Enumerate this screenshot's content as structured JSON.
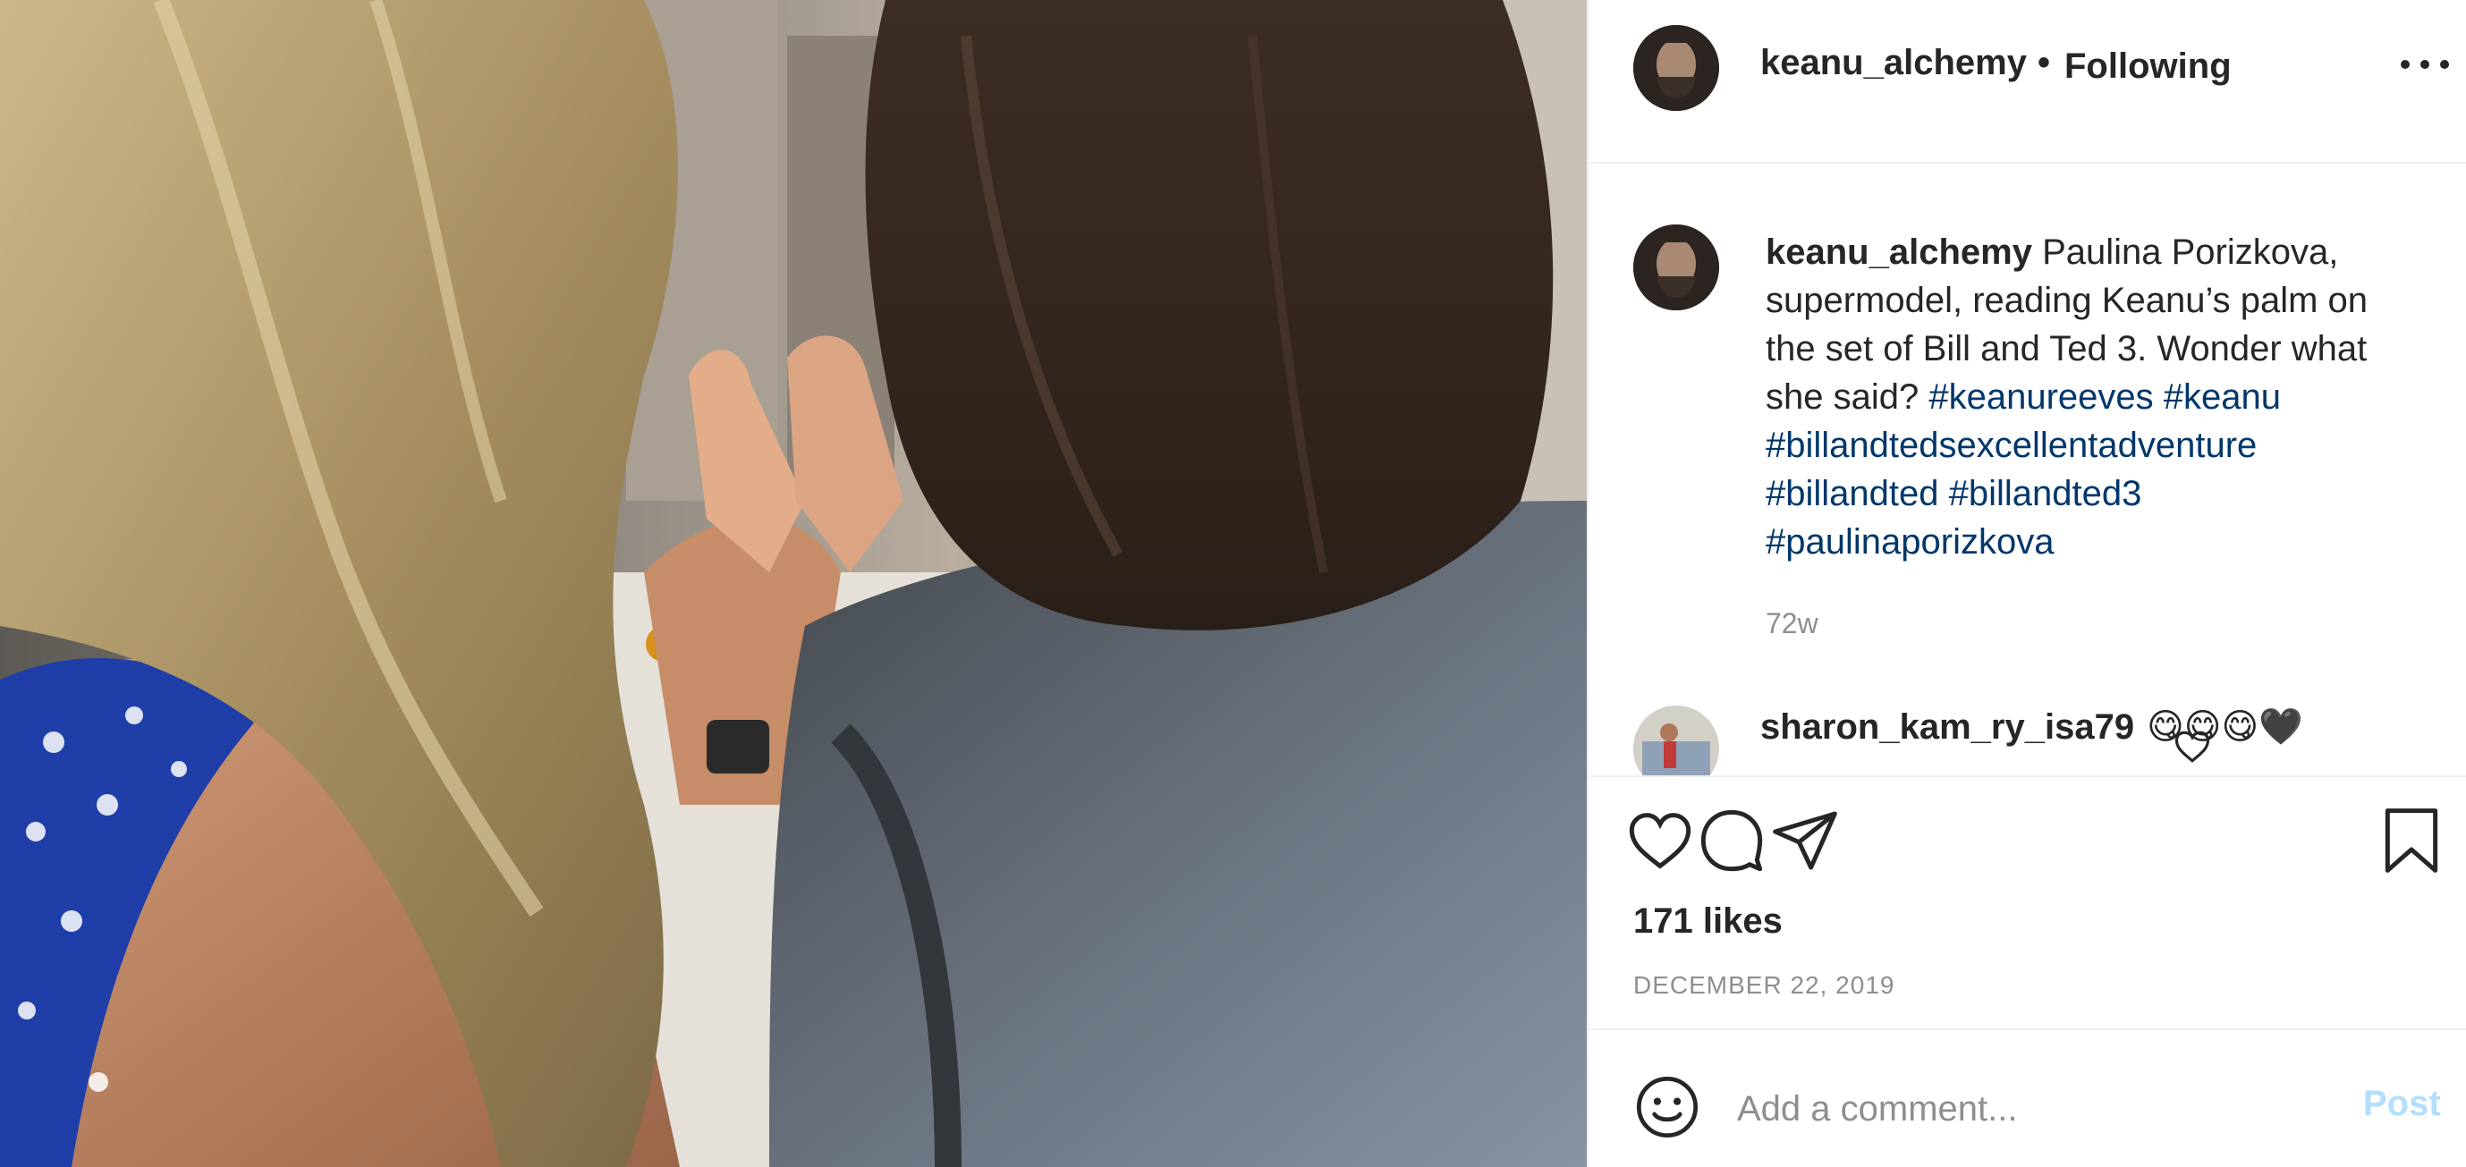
{
  "header": {
    "username": "keanu_alchemy",
    "separator": "•",
    "follow_status": "Following",
    "more_icon": "more-horizontal-icon"
  },
  "caption": {
    "username": "keanu_alchemy",
    "text": "Paulina Porizkova, supermodel, reading Keanu’s palm on the set of Bill and Ted 3. Wonder what she said?",
    "hashtags": [
      "#keanureeves",
      "#keanu",
      "#billandtedsexcellentadventure",
      "#billandted",
      "#billandted3",
      "#paulinaporizkova"
    ],
    "age": "72w"
  },
  "comments": [
    {
      "username": "sharon_kam_ry_isa79",
      "text": "😋😋😋🖤",
      "like_icon": "heart-outline-icon"
    }
  ],
  "actions": {
    "icons": [
      "heart-outline-icon",
      "comment-bubble-icon",
      "paper-plane-icon",
      "bookmark-icon"
    ]
  },
  "likes": "171 likes",
  "date": "DECEMBER 22, 2019",
  "add_comment": {
    "placeholder": "Add a comment...",
    "post_label": "Post",
    "emoji_icon": "smiley-face-icon"
  },
  "colors": {
    "text": "#262626",
    "muted": "#8e8e8e",
    "hashtag": "#00376b",
    "post_disabled": "#b2dffc",
    "divider": "#efefef"
  }
}
